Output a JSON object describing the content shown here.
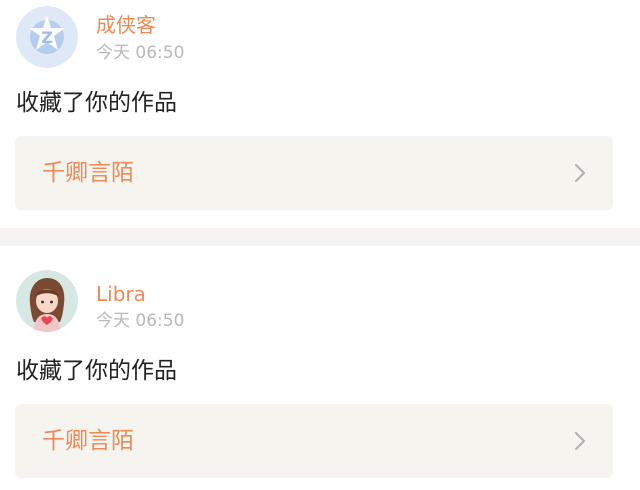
{
  "notifications": [
    {
      "username": "成侠客",
      "time": "今天 06:50",
      "action": "收藏了你的作品",
      "work_title": "千卿言陌",
      "avatar_icon": "default-avatar-icon"
    },
    {
      "username": "Libra",
      "time": "今天 06:50",
      "action": "收藏了你的作品",
      "work_title": "千卿言陌",
      "avatar_icon": "cartoon-girl-avatar"
    }
  ],
  "colors": {
    "accent": "#ef8a56",
    "time": "#b9b9b9",
    "text": "#222222",
    "link_bg": "#f5f4ef",
    "divider": "#f6f4f2"
  }
}
